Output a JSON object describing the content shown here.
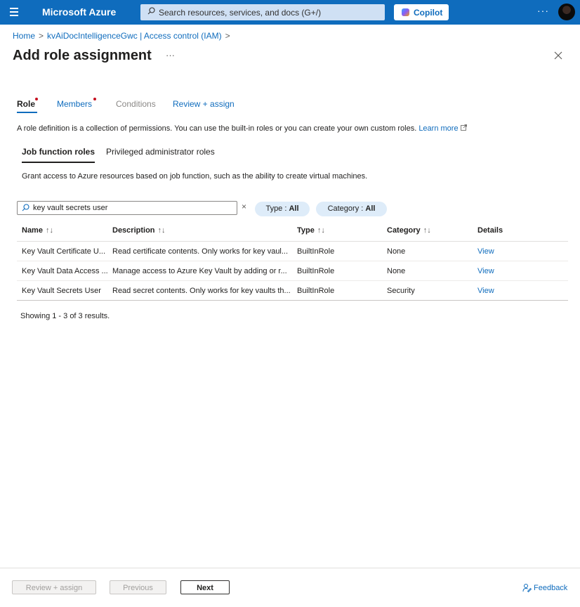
{
  "topbar": {
    "brand": "Microsoft Azure",
    "search_placeholder": "Search resources, services, and docs (G+/)",
    "copilot_label": "Copilot",
    "more": "···"
  },
  "breadcrumb": {
    "home": "Home",
    "resource": "kvAiDocIntelligenceGwc | Access control (IAM)",
    "sep": ">"
  },
  "page": {
    "title": "Add role assignment",
    "more": "···"
  },
  "tabs": [
    {
      "label": "Role",
      "required": true
    },
    {
      "label": "Members",
      "required": true
    },
    {
      "label": "Conditions"
    },
    {
      "label": "Review + assign"
    }
  ],
  "description": {
    "text": "A role definition is a collection of permissions. You can use the built-in roles or you can create your own custom roles. ",
    "link": "Learn more"
  },
  "subtabs": [
    "Job function roles",
    "Privileged administrator roles"
  ],
  "grant_text": "Grant access to Azure resources based on job function, such as the ability to create virtual machines.",
  "filter": {
    "search_value": "key vault secrets user",
    "clear": "×",
    "type_label": "Type : ",
    "type_value": "All",
    "category_label": "Category : ",
    "category_value": "All"
  },
  "table": {
    "columns": [
      "Name",
      "Description",
      "Type",
      "Category",
      "Details"
    ],
    "sort_name": "↑↓",
    "sort_other": "↑↓",
    "rows": [
      {
        "name": "Key Vault Certificate U...",
        "description": "Read certificate contents. Only works for key vaul...",
        "type": "BuiltInRole",
        "category": "None",
        "details": "View"
      },
      {
        "name": "Key Vault Data Access ...",
        "description": "Manage access to Azure Key Vault by adding or r...",
        "type": "BuiltInRole",
        "category": "None",
        "details": "View"
      },
      {
        "name": "Key Vault Secrets User",
        "description": "Read secret contents. Only works for key vaults th...",
        "type": "BuiltInRole",
        "category": "Security",
        "details": "View"
      }
    ]
  },
  "results_text": "Showing 1 - 3 of 3 results.",
  "footer": {
    "review_assign": "Review + assign",
    "previous": "Previous",
    "next": "Next",
    "feedback": "Feedback"
  },
  "colors": {
    "topbar": "#0f6cbd",
    "link": "#0f6cbd",
    "required_dot": "#c50f1f",
    "pill_bg": "#deecf9"
  }
}
